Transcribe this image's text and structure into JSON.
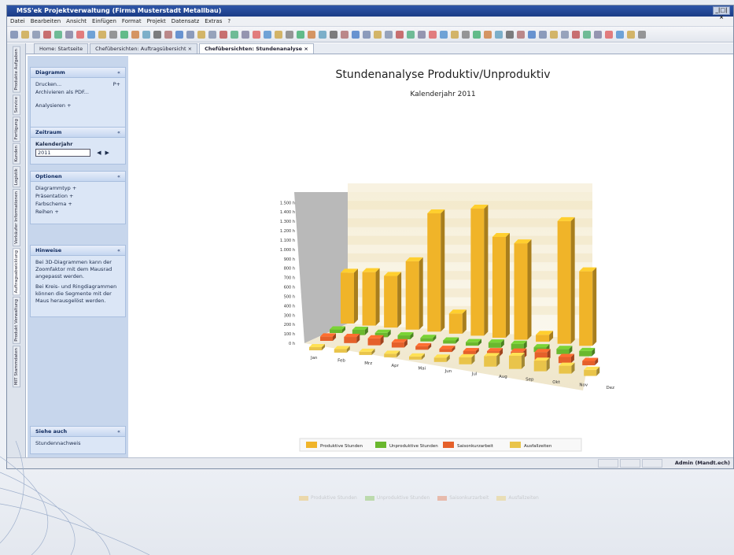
{
  "window": {
    "title": "MSS'ek Projektverwaltung (Firma Musterstadt Metallbau)",
    "ctrl": "_|□|×"
  },
  "menu": [
    "Datei",
    "Bearbeiten",
    "Ansicht",
    "Einfügen",
    "Format",
    "Projekt",
    "Datensatz",
    "Extras",
    "?"
  ],
  "tabs": [
    {
      "label": "Home: Startseite"
    },
    {
      "label": "Chefübersichten: Auftragsübersicht ×"
    },
    {
      "label": "Chefübersichten: Stundenanalyse ×",
      "active": true
    }
  ],
  "vtabs": [
    "Produkte Aufgaben",
    "Service",
    "Fertigung",
    "Kunden",
    "Logistik",
    "Verkäufer Informationen",
    "Auftragsabwicklung",
    "Produkt Verwaltung",
    "MIT Stammdaten"
  ],
  "sidebar": {
    "diagramm": {
      "title": "Diagramm",
      "items": [
        "Drucken...",
        "Archivieren als PDF...",
        "Analysieren +"
      ],
      "shortcut": "P+"
    },
    "zeitraum": {
      "title": "Zeitraum",
      "label": "Kalenderjahr",
      "value": "2011",
      "prev": "◀",
      "next": "▶"
    },
    "optionen": {
      "title": "Optionen",
      "items": [
        "Diagrammtyp +",
        "Präsentation +",
        "Farbschema +",
        "Reihen +"
      ]
    },
    "hinweise": {
      "title": "Hinweise",
      "text1": "Bei 3D-Diagrammen kann der Zoomfaktor mit dem Mausrad angepasst werden.",
      "text2": "Bei Kreis- und Ringdiagrammen können die Segmente mit der Maus herausgelöst werden."
    },
    "siehe_auch": {
      "title": "Siehe auch",
      "items": [
        "Stundennachweis"
      ]
    },
    "chevron": "«"
  },
  "status": {
    "user": "Admin (Mandt.ech)"
  },
  "colors": {
    "prod": "#f0b429",
    "unprod": "#6ab82e",
    "saison": "#e5602a",
    "ausfall": "#e9c44a"
  },
  "chart_data": {
    "type": "bar",
    "title": "Stundenanalyse Produktiv/Unproduktiv",
    "subtitle": "Kalenderjahr 2011",
    "categories": [
      "Jan",
      "Feb",
      "Mrz",
      "Apr",
      "Mai",
      "Jun",
      "Jul",
      "Aug",
      "Sep",
      "Okt",
      "Nov",
      "Dez"
    ],
    "yticks": [
      "0 h",
      "100 h",
      "200 h",
      "300 h",
      "400 h",
      "500 h",
      "600 h",
      "700 h",
      "800 h",
      "900 h",
      "1.000 h",
      "1.100 h",
      "1.200 h",
      "1.300 h",
      "1.400 h",
      "1.500 h"
    ],
    "ylim": [
      0,
      1500
    ],
    "grid": true,
    "series": [
      {
        "name": "Produktive Stunden",
        "color": "#f0b429",
        "values": [
          580,
          610,
          590,
          780,
          1350,
          230,
          1450,
          1150,
          1100,
          80,
          1400,
          850
        ]
      },
      {
        "name": "Unproduktive Stunden",
        "color": "#6ab82e",
        "values": [
          40,
          60,
          50,
          45,
          40,
          35,
          40,
          60,
          70,
          55,
          60,
          60
        ]
      },
      {
        "name": "Saisonkurzarbeit",
        "color": "#e5602a",
        "values": [
          50,
          70,
          80,
          60,
          40,
          30,
          30,
          60,
          80,
          100,
          70,
          50
        ]
      },
      {
        "name": "Ausfallzeiten",
        "color": "#e9c44a",
        "values": [
          30,
          40,
          30,
          40,
          30,
          50,
          80,
          120,
          150,
          120,
          90,
          70
        ]
      }
    ],
    "legend_position": "bottom"
  }
}
